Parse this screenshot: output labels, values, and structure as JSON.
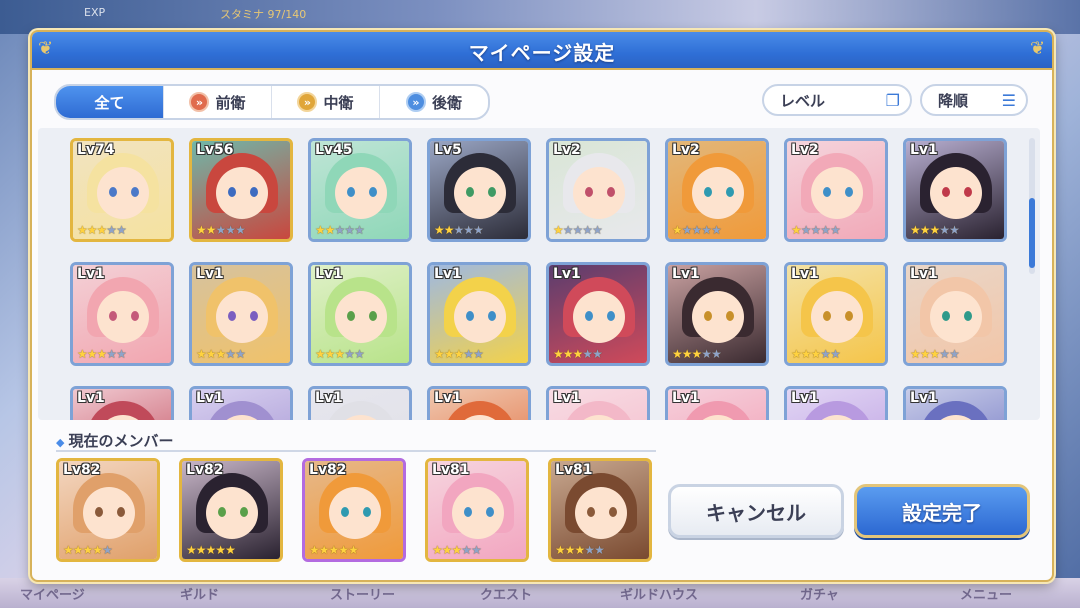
{
  "background": {
    "exp_label": "EXP",
    "stamina_label": "スタミナ 97/140",
    "bottom_menu": [
      "マイページ",
      "ギルド",
      "ストーリー",
      "クエスト",
      "ギルドハウス",
      "ガチャ",
      "メニュー"
    ]
  },
  "dialog": {
    "title": "マイページ設定",
    "filters": [
      {
        "label": "全て",
        "active": true
      },
      {
        "label": "前衛",
        "icon": "front-position-icon"
      },
      {
        "label": "中衛",
        "icon": "middle-position-icon"
      },
      {
        "label": "後衛",
        "icon": "rear-position-icon"
      }
    ],
    "sort_key": "レベル",
    "sort_order": "降順",
    "grid": [
      {
        "lv": "Lv74",
        "stars": 3,
        "frame": "gold",
        "hair": "#f5e2a0",
        "bg": "#f1e3c0",
        "eye": "#4b79c8"
      },
      {
        "lv": "Lv56",
        "stars": 2,
        "frame": "gold",
        "hair": "#c9473e",
        "bg": "#6fb7a9",
        "eye": "#3d6bc0"
      },
      {
        "lv": "Lv45",
        "stars": 2,
        "frame": "silver",
        "hair": "#8fd7b8",
        "bg": "#bfe5d6",
        "eye": "#3f8fc8"
      },
      {
        "lv": "Lv5",
        "stars": 2,
        "frame": "silver",
        "hair": "#2c2c38",
        "bg": "#9aa6c4",
        "eye": "#3f9a64"
      },
      {
        "lv": "Lv2",
        "stars": 1,
        "frame": "silver",
        "hair": "#e8e8ec",
        "bg": "#d9e6d6",
        "eye": "#c0506a"
      },
      {
        "lv": "Lv2",
        "stars": 1,
        "frame": "silver",
        "hair": "#f09a3a",
        "bg": "#e2b77a",
        "eye": "#2f9ab0"
      },
      {
        "lv": "Lv2",
        "stars": 1,
        "frame": "silver",
        "hair": "#f2a9b8",
        "bg": "#f4d4dc",
        "eye": "#3f8fc8"
      },
      {
        "lv": "Lv1",
        "stars": 3,
        "frame": "silver",
        "hair": "#2a2230",
        "bg": "#b7aed0",
        "eye": "#c03a4a"
      },
      {
        "lv": "Lv1",
        "stars": 3,
        "frame": "silver",
        "hair": "#f2a6b0",
        "bg": "#f3d0d6",
        "eye": "#c45a7a"
      },
      {
        "lv": "Lv1",
        "stars": 3,
        "frame": "silver",
        "hair": "#f0c26a",
        "bg": "#d6c29e",
        "eye": "#7a5ec0"
      },
      {
        "lv": "Lv1",
        "stars": 3,
        "frame": "silver",
        "hair": "#b8e38a",
        "bg": "#dff0c8",
        "eye": "#5aa04a"
      },
      {
        "lv": "Lv1",
        "stars": 3,
        "frame": "silver",
        "hair": "#f3d24a",
        "bg": "#9fb9e0",
        "eye": "#3f8fc8"
      },
      {
        "lv": "Lv1",
        "stars": 3,
        "frame": "silver",
        "hair": "#d04a5a",
        "bg": "#5a3d6e",
        "eye": "#3f8fc8"
      },
      {
        "lv": "Lv1",
        "stars": 3,
        "frame": "silver",
        "hair": "#3a2a30",
        "bg": "#c8a0a0",
        "eye": "#c8902a"
      },
      {
        "lv": "Lv1",
        "stars": 3,
        "frame": "silver",
        "hair": "#f5c54a",
        "bg": "#f3e2a6",
        "eye": "#c8902a"
      },
      {
        "lv": "Lv1",
        "stars": 3,
        "frame": "silver",
        "hair": "#f2c6a8",
        "bg": "#e9d6c8",
        "eye": "#2f9a8a"
      },
      {
        "lv": "Lv1",
        "stars": 0,
        "frame": "silver",
        "hair": "#c04a5a",
        "bg": "#f0c8d0",
        "eye": "#3f8fc8"
      },
      {
        "lv": "Lv1",
        "stars": 0,
        "frame": "silver",
        "hair": "#a090d0",
        "bg": "#d8d0f0",
        "eye": "#3f8fc8"
      },
      {
        "lv": "Lv1",
        "stars": 0,
        "frame": "silver",
        "hair": "#e0e0e6",
        "bg": "#e6e6ee",
        "eye": "#3f8fc8"
      },
      {
        "lv": "Lv1",
        "stars": 0,
        "frame": "silver",
        "hair": "#e06a3a",
        "bg": "#f0c8b0",
        "eye": "#3f8fc8"
      },
      {
        "lv": "Lv1",
        "stars": 0,
        "frame": "silver",
        "hair": "#f3b8c8",
        "bg": "#f8dce4",
        "eye": "#3f8fc8"
      },
      {
        "lv": "Lv1",
        "stars": 0,
        "frame": "silver",
        "hair": "#f09ab0",
        "bg": "#f6d0dc",
        "eye": "#3f8fc8"
      },
      {
        "lv": "Lv1",
        "stars": 0,
        "frame": "silver",
        "hair": "#b89ae0",
        "bg": "#e2d6f4",
        "eye": "#3f8fc8"
      },
      {
        "lv": "Lv1",
        "stars": 0,
        "frame": "silver",
        "hair": "#6a70c0",
        "bg": "#c8cce8",
        "eye": "#3f8fc8"
      }
    ],
    "current_members_label": "現在のメンバー",
    "members": [
      {
        "lv": "Lv82",
        "stars": 4,
        "frame": "gold",
        "hair": "#e0a06a",
        "bg": "#f3d6c0",
        "eye": "#8a5a3a"
      },
      {
        "lv": "Lv82",
        "stars": 5,
        "frame": "gold",
        "hair": "#2a2230",
        "bg": "#c8b6c8",
        "eye": "#5aa04a"
      },
      {
        "lv": "Lv82",
        "stars": 5,
        "frame": "purple",
        "hair": "#f09a3a",
        "bg": "#e6b88a",
        "eye": "#2f9ab0"
      },
      {
        "lv": "Lv81",
        "stars": 3,
        "frame": "gold",
        "hair": "#f2a6c0",
        "bg": "#f6d4de",
        "eye": "#3f8fc8"
      },
      {
        "lv": "Lv81",
        "stars": 3,
        "frame": "gold",
        "hair": "#7a4a30",
        "bg": "#c8a890",
        "eye": "#8a5a3a"
      }
    ],
    "cancel_label": "キャンセル",
    "confirm_label": "設定完了"
  }
}
